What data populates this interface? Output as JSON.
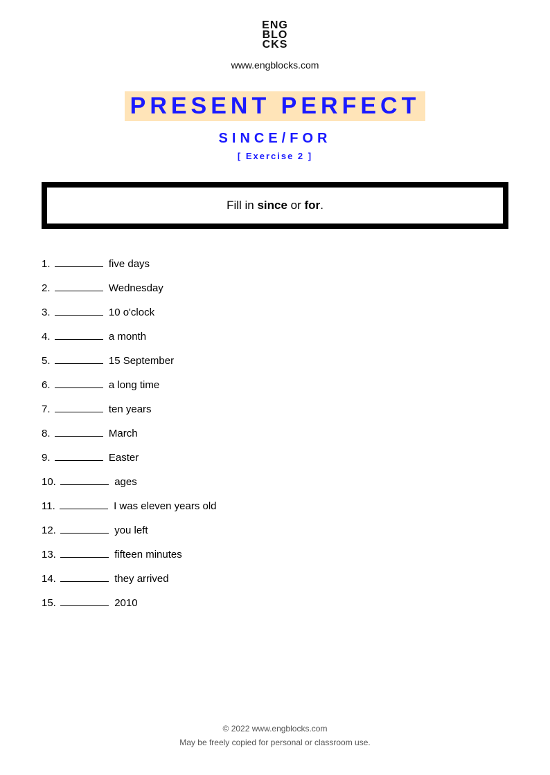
{
  "header": {
    "logo_lines": [
      "ENG",
      "BLO",
      "CKS"
    ],
    "website": "www.engblocks.com"
  },
  "title": {
    "main": "PRESENT PERFECT",
    "sub": "SINCE/FOR",
    "exercise": "[ Exercise 2 ]"
  },
  "instruction": {
    "pre": "Fill in ",
    "word1": "since",
    "mid": " or ",
    "word2": "for",
    "post": "."
  },
  "items": [
    {
      "num": "1.",
      "text": "five days"
    },
    {
      "num": "2.",
      "text": "Wednesday"
    },
    {
      "num": "3.",
      "text": "10 o'clock"
    },
    {
      "num": "4.",
      "text": "a month"
    },
    {
      "num": "5.",
      "text": "15 September"
    },
    {
      "num": "6.",
      "text": "a long time"
    },
    {
      "num": "7.",
      "text": "ten years"
    },
    {
      "num": "8.",
      "text": "March"
    },
    {
      "num": "9.",
      "text": "Easter"
    },
    {
      "num": "10.",
      "text": "ages"
    },
    {
      "num": "11.",
      "text": "I was eleven years old"
    },
    {
      "num": "12.",
      "text": "you left"
    },
    {
      "num": "13.",
      "text": "fifteen minutes"
    },
    {
      "num": "14.",
      "text": "they arrived"
    },
    {
      "num": "15.",
      "text": "2010"
    }
  ],
  "footer": {
    "copyright": "© 2022 www.engblocks.com",
    "license": "May be freely copied for personal or classroom use."
  }
}
